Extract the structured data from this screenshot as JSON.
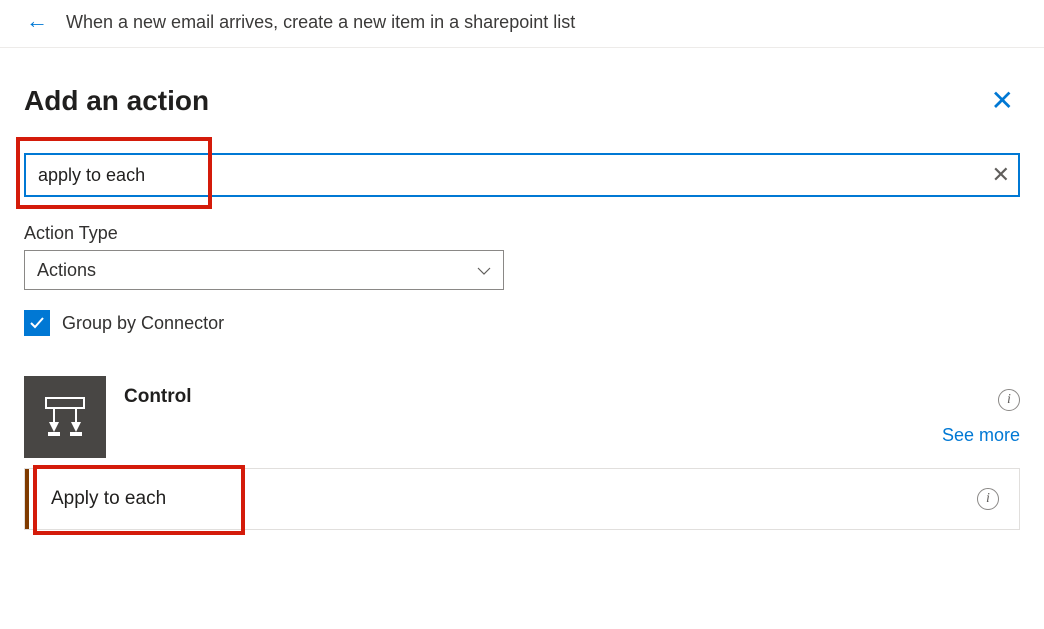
{
  "breadcrumb": {
    "title": "When a new email arrives, create a new item in a sharepoint list"
  },
  "panel": {
    "title": "Add an action"
  },
  "search": {
    "value": "apply to each"
  },
  "action_type": {
    "label": "Action Type",
    "selected": "Actions"
  },
  "group_by": {
    "label": "Group by Connector",
    "checked": true
  },
  "connector": {
    "name": "Control",
    "see_more": "See more"
  },
  "actions": [
    {
      "name": "Apply to each"
    }
  ]
}
